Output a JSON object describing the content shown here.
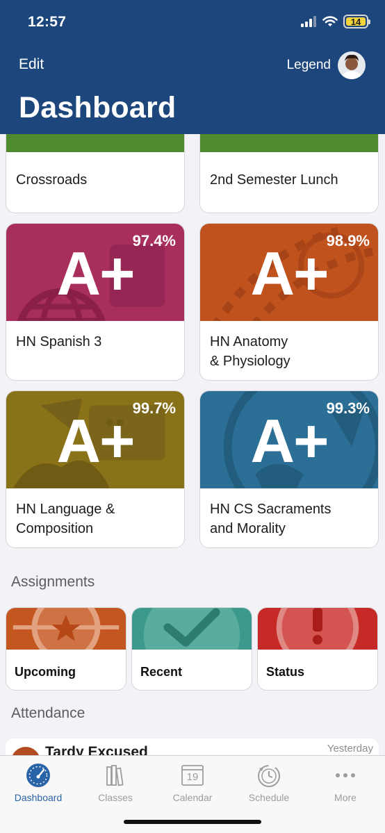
{
  "status_bar": {
    "time": "12:57",
    "battery": "14"
  },
  "header": {
    "edit_label": "Edit",
    "user_label": "Legend",
    "title": "Dashboard"
  },
  "top_cards": [
    {
      "label": "Crossroads"
    },
    {
      "label": "2nd Semester Lunch"
    }
  ],
  "courses": [
    {
      "grade": "A+",
      "percent": "97.4%",
      "name": "HN Spanish 3",
      "color": "#a82e5c"
    },
    {
      "grade": "A+",
      "percent": "98.9%",
      "name_line1": "HN Anatomy",
      "name_line2": "& Physiology",
      "color": "#c0521d"
    },
    {
      "grade": "A+",
      "percent": "99.7%",
      "name_line1": "HN Language &",
      "name_line2": "Composition",
      "color": "#8a7219"
    },
    {
      "grade": "A+",
      "percent": "99.3%",
      "name_line1": "HN CS Sacraments",
      "name_line2": "and Morality",
      "color": "#2b6f96"
    }
  ],
  "assignments": {
    "section_title": "Assignments",
    "items": [
      {
        "label": "Upcoming",
        "icon": "star-icon",
        "color": "#c4561f"
      },
      {
        "label": "Recent",
        "icon": "check-icon",
        "color": "#3b9a8b"
      },
      {
        "label": "Status",
        "icon": "exclamation-icon",
        "color": "#c62a26"
      }
    ]
  },
  "attendance": {
    "section_title": "Attendance",
    "item": {
      "title": "Tardy Excused",
      "time": "Yesterday"
    }
  },
  "tabbar": {
    "items": [
      {
        "label": "Dashboard",
        "icon": "speedometer-icon"
      },
      {
        "label": "Classes",
        "icon": "books-icon"
      },
      {
        "label": "Calendar",
        "icon": "calendar-icon",
        "day": "19"
      },
      {
        "label": "Schedule",
        "icon": "clock-icon"
      },
      {
        "label": "More",
        "icon": "more-icon"
      }
    ],
    "active": "Dashboard"
  },
  "colors": {
    "header": "#1d477c",
    "accent": "#2a64a8",
    "background": "#f2f2f7"
  }
}
